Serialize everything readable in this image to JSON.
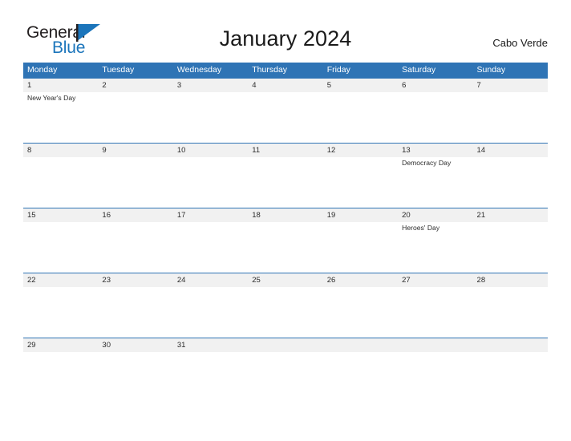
{
  "brand": {
    "name_part1": "General",
    "name_part2": "Blue",
    "flag_icon": "blue-triangle-flag-icon",
    "accent_color": "#1b75bb"
  },
  "header": {
    "title": "January 2024",
    "location": "Cabo Verde"
  },
  "theme": {
    "header_blue": "#2f74b5",
    "band_gray": "#f1f1f1",
    "text_color": "#2b2b2b"
  },
  "calendar": {
    "weekdays": [
      "Monday",
      "Tuesday",
      "Wednesday",
      "Thursday",
      "Friday",
      "Saturday",
      "Sunday"
    ],
    "weeks": [
      {
        "days": [
          {
            "date": "1",
            "event": "New Year's Day"
          },
          {
            "date": "2",
            "event": ""
          },
          {
            "date": "3",
            "event": ""
          },
          {
            "date": "4",
            "event": ""
          },
          {
            "date": "5",
            "event": ""
          },
          {
            "date": "6",
            "event": ""
          },
          {
            "date": "7",
            "event": ""
          }
        ]
      },
      {
        "days": [
          {
            "date": "8",
            "event": ""
          },
          {
            "date": "9",
            "event": ""
          },
          {
            "date": "10",
            "event": ""
          },
          {
            "date": "11",
            "event": ""
          },
          {
            "date": "12",
            "event": ""
          },
          {
            "date": "13",
            "event": "Democracy Day"
          },
          {
            "date": "14",
            "event": ""
          }
        ]
      },
      {
        "days": [
          {
            "date": "15",
            "event": ""
          },
          {
            "date": "16",
            "event": ""
          },
          {
            "date": "17",
            "event": ""
          },
          {
            "date": "18",
            "event": ""
          },
          {
            "date": "19",
            "event": ""
          },
          {
            "date": "20",
            "event": "Heroes' Day"
          },
          {
            "date": "21",
            "event": ""
          }
        ]
      },
      {
        "days": [
          {
            "date": "22",
            "event": ""
          },
          {
            "date": "23",
            "event": ""
          },
          {
            "date": "24",
            "event": ""
          },
          {
            "date": "25",
            "event": ""
          },
          {
            "date": "26",
            "event": ""
          },
          {
            "date": "27",
            "event": ""
          },
          {
            "date": "28",
            "event": ""
          }
        ]
      },
      {
        "short": true,
        "days": [
          {
            "date": "29",
            "event": ""
          },
          {
            "date": "30",
            "event": ""
          },
          {
            "date": "31",
            "event": ""
          },
          {
            "date": "",
            "event": ""
          },
          {
            "date": "",
            "event": ""
          },
          {
            "date": "",
            "event": ""
          },
          {
            "date": "",
            "event": ""
          }
        ]
      }
    ]
  }
}
